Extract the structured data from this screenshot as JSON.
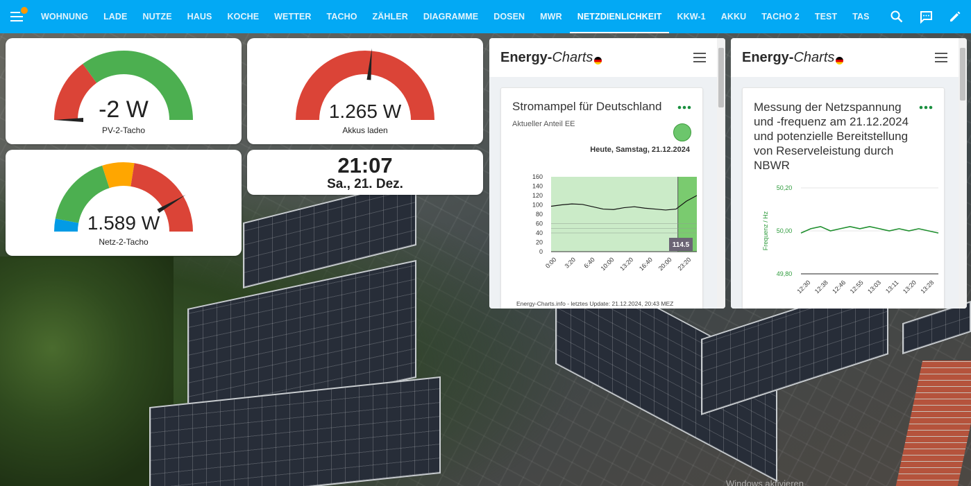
{
  "nav": {
    "tabs": [
      "WOHNUNG",
      "LADE",
      "NUTZE",
      "HAUS",
      "KOCHE",
      "WETTER",
      "TACHO",
      "ZÄHLER",
      "DIAGRAMME",
      "DOSEN",
      "MWR",
      "NETZDIENLICHKEIT",
      "KKW-1",
      "AKKU",
      "TACHO 2",
      "TEST",
      "TAS"
    ],
    "active_tab": "NETZDIENLICHKEIT",
    "icons": [
      "menu-icon",
      "search-icon",
      "chat-icon",
      "pencil-icon"
    ]
  },
  "gauges": {
    "pv2": {
      "value": "-2 W",
      "label": "PV-2-Tacho",
      "fraction": 0.0
    },
    "akkus": {
      "value": "1.265 W",
      "label": "Akkus laden",
      "fraction": 0.53
    },
    "netz2": {
      "value": "1.589 W",
      "label": "Netz-2-Tacho",
      "fraction": 0.83
    }
  },
  "clock": {
    "time": "21:07",
    "date": "Sa., 21. Dez."
  },
  "colors": {
    "accent": "#03a9f4",
    "green": "#4caf50",
    "red": "#db4437",
    "orange": "#ffa600",
    "blue": "#039be5"
  },
  "energy_charts_1": {
    "logo_main": "Energy-",
    "logo_italic": "Charts",
    "title": "Stromampel für Deutschland",
    "subtitle": "Aktueller Anteil EE",
    "date": "Heute, Samstag, 21.12.2024",
    "badge": "114.5",
    "footer": "Energy-Charts.info - letztes Update: 21.12.2024, 20:43 MEZ",
    "y_ticks": [
      "160",
      "140",
      "120",
      "100",
      "80",
      "60",
      "40",
      "20",
      "0"
    ],
    "x_ticks": [
      "0:00",
      "3:20",
      "6:40",
      "10:00",
      "13:20",
      "16:40",
      "20:00",
      "23:20"
    ],
    "chart_data": {
      "type": "line",
      "ylim": [
        0,
        160
      ],
      "x": [
        "0:00",
        "1:40",
        "3:20",
        "5:00",
        "6:40",
        "8:20",
        "10:00",
        "11:40",
        "13:20",
        "15:00",
        "16:40",
        "18:20",
        "20:00",
        "21:40",
        "23:20"
      ],
      "values": [
        97,
        100,
        102,
        101,
        96,
        91,
        90,
        94,
        96,
        93,
        91,
        89,
        91,
        108,
        120
      ]
    }
  },
  "energy_charts_2": {
    "logo_main": "Energy-",
    "logo_italic": "Charts",
    "title": "Messung der Netzspannung und -frequenz am 21.12.2024 und potenzielle Bereitstellung von Reserveleistung durch NBWR",
    "y_label": "Frequenz / Hz",
    "y_ticks": [
      "50,20",
      "50,00",
      "49,80"
    ],
    "x_ticks": [
      "12:30",
      "12:38",
      "12:46",
      "12:55",
      "13:03",
      "13:11",
      "13:20",
      "13:28"
    ],
    "chart_data": {
      "type": "line",
      "ylim": [
        49.8,
        50.2
      ],
      "x": [
        "12:30",
        "12:34",
        "12:38",
        "12:42",
        "12:46",
        "12:50",
        "12:55",
        "12:59",
        "13:03",
        "13:07",
        "13:11",
        "13:15",
        "13:20",
        "13:24",
        "13:28"
      ],
      "values": [
        49.99,
        50.01,
        50.02,
        50.0,
        50.01,
        50.02,
        50.01,
        50.02,
        50.01,
        50.0,
        50.01,
        50.0,
        50.01,
        50.0,
        49.99
      ]
    }
  },
  "watermark": "Windows aktivieren"
}
